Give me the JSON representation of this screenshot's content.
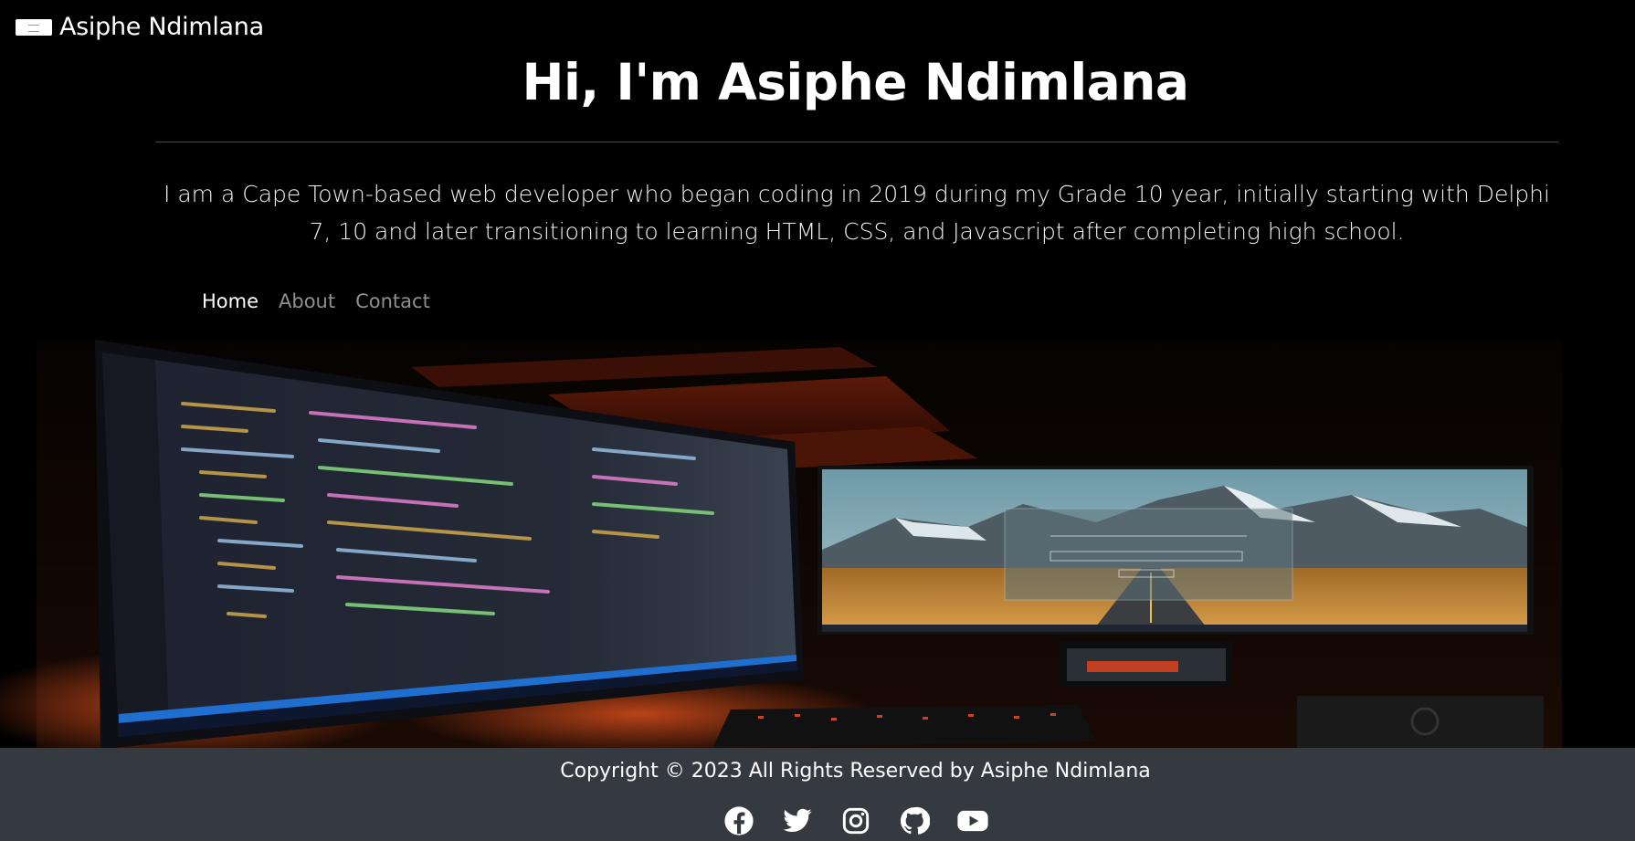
{
  "brand": {
    "name": "Asiphe Ndimlana",
    "logo_icon": "laptop-logo-icon"
  },
  "hero": {
    "title": "Hi, I'm Asiphe Ndimlana",
    "intro": "I am a Cape Town-based web developer who began coding in 2019 during my Grade 10 year, initially starting with Delphi 7, 10 and later transitioning to learning HTML, CSS, and Javascript after completing high school."
  },
  "nav": {
    "items": [
      {
        "label": "Home",
        "active": true
      },
      {
        "label": "About",
        "active": false
      },
      {
        "label": "Contact",
        "active": false
      }
    ]
  },
  "footer": {
    "copyright": "Copyright © 2023 All Rights Reserved by Asiphe Ndimlana",
    "socials": [
      "facebook-icon",
      "twitter-icon",
      "instagram-icon",
      "github-icon",
      "youtube-icon"
    ]
  },
  "colors": {
    "background": "#000000",
    "footer": "#343a40",
    "nav_inactive": "#8f8f8f",
    "text": "#ffffff"
  }
}
